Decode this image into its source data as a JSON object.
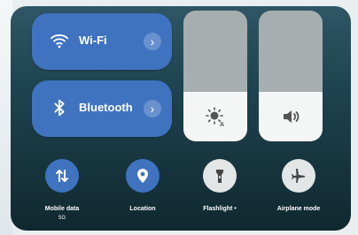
{
  "tiles": {
    "wifi": {
      "label": "Wi-Fi",
      "chevron": "›"
    },
    "bluetooth": {
      "label": "Bluetooth",
      "chevron": "›"
    }
  },
  "sliders": {
    "brightness": {
      "level_percent": 38
    },
    "volume": {
      "level_percent": 38
    }
  },
  "toggles": [
    {
      "label": "Mobile data",
      "sublabel": "5G",
      "icon": "data-transfer-icon",
      "active": true
    },
    {
      "label": "Location",
      "icon": "location-pin-icon",
      "active": true
    },
    {
      "label": "Flashlight •",
      "icon": "flashlight-icon",
      "active": false
    },
    {
      "label": "Airplane mode",
      "icon": "airplane-icon",
      "active": false
    }
  ],
  "colors": {
    "accent": "#3f73c0",
    "inactive": "#e3e6e6",
    "slider_track": "#a6aeb0",
    "slider_fill": "#f4f5f5"
  }
}
